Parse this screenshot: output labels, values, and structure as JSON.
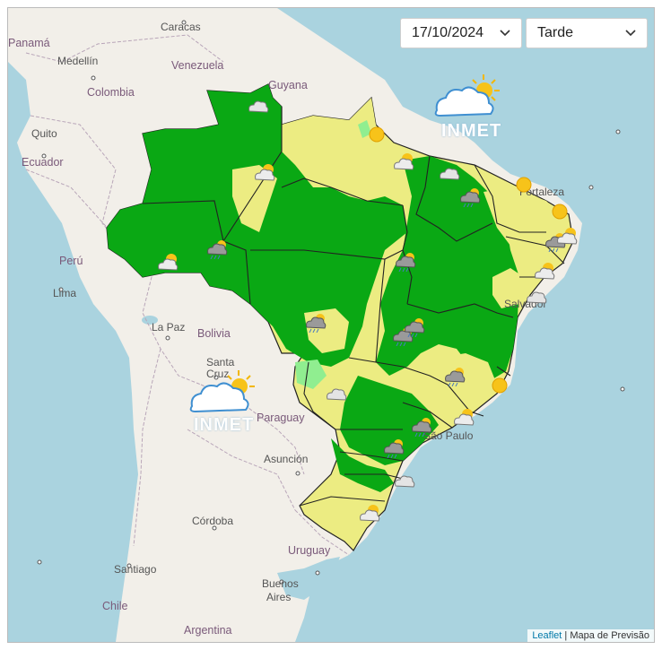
{
  "controls": {
    "date_value": "17/10/2024",
    "period_value": "Tarde"
  },
  "logo": {
    "text": "INMET"
  },
  "logo_watermark": {
    "text": "INMET"
  },
  "attribution": {
    "link": "Leaflet",
    "separator": " | ",
    "text": "Mapa de Previsão"
  },
  "map_labels": [
    {
      "text": "Panamá",
      "kind": "country"
    },
    {
      "text": "Caracas",
      "kind": "city"
    },
    {
      "text": "Medellín",
      "kind": "city"
    },
    {
      "text": "Venezuela",
      "kind": "country"
    },
    {
      "text": "Guyana",
      "kind": "country"
    },
    {
      "text": "Colombia",
      "kind": "country"
    },
    {
      "text": "Quito",
      "kind": "city"
    },
    {
      "text": "Ecuador",
      "kind": "country"
    },
    {
      "text": "Perú",
      "kind": "country"
    },
    {
      "text": "Lima",
      "kind": "city"
    },
    {
      "text": "La Paz",
      "kind": "city"
    },
    {
      "text": "Bolivia",
      "kind": "country"
    },
    {
      "text": "Santa",
      "kind": "city"
    },
    {
      "text": "Cruz",
      "kind": "city"
    },
    {
      "text": "Paraguay",
      "kind": "country"
    },
    {
      "text": "Asunción",
      "kind": "city"
    },
    {
      "text": "Córdoba",
      "kind": "city"
    },
    {
      "text": "Uruguay",
      "kind": "country"
    },
    {
      "text": "Santiago",
      "kind": "city"
    },
    {
      "text": "Buenos",
      "kind": "city"
    },
    {
      "text": "Aires",
      "kind": "city"
    },
    {
      "text": "Chile",
      "kind": "country"
    },
    {
      "text": "Argentina",
      "kind": "country"
    },
    {
      "text": "Salvador",
      "kind": "city"
    },
    {
      "text": "São Paulo",
      "kind": "city"
    },
    {
      "text": "Fortaleza",
      "kind": "city"
    }
  ],
  "colors": {
    "ocean": "#aad3df",
    "land": "#f2efe9",
    "forecast_green": "#0aa814",
    "forecast_yellow": "#ecec82",
    "forecast_light_green": "#90ee90",
    "state_border": "#222222"
  },
  "weather_icons": [
    {
      "name": "cloudy",
      "region": "Roraima"
    },
    {
      "name": "partly-cloudy",
      "region": "Amazonas north"
    },
    {
      "name": "sun",
      "region": "Amapá/Pará north"
    },
    {
      "name": "cloudy",
      "region": "Maranhão"
    },
    {
      "name": "partly-cloudy",
      "region": "Ceará"
    },
    {
      "name": "storm",
      "region": "Piauí"
    },
    {
      "name": "sun",
      "region": "Rio Grande do Norte"
    },
    {
      "name": "sun",
      "region": "Paraíba"
    },
    {
      "name": "storm",
      "region": "Pernambuco"
    },
    {
      "name": "partly-cloudy",
      "region": "Alagoas"
    },
    {
      "name": "cloudy",
      "region": "Sergipe"
    },
    {
      "name": "partly-cloudy",
      "region": "Bahia"
    },
    {
      "name": "storm",
      "region": "Acre"
    },
    {
      "name": "partly-cloudy",
      "region": "Amazonas south"
    },
    {
      "name": "storm",
      "region": "Tocantins"
    },
    {
      "name": "storm",
      "region": "Mato Grosso"
    },
    {
      "name": "storm",
      "region": "Goiás"
    },
    {
      "name": "storm",
      "region": "Distrito Federal"
    },
    {
      "name": "cloudy",
      "region": "Mato Grosso do Sul"
    },
    {
      "name": "storm",
      "region": "Minas Gerais"
    },
    {
      "name": "sun",
      "region": "Espírito Santo"
    },
    {
      "name": "partly-cloudy",
      "region": "Rio de Janeiro"
    },
    {
      "name": "storm",
      "region": "São Paulo"
    },
    {
      "name": "storm",
      "region": "Paraná"
    },
    {
      "name": "cloudy",
      "region": "Santa Catarina"
    },
    {
      "name": "partly-cloudy",
      "region": "Rio Grande do Sul"
    }
  ]
}
